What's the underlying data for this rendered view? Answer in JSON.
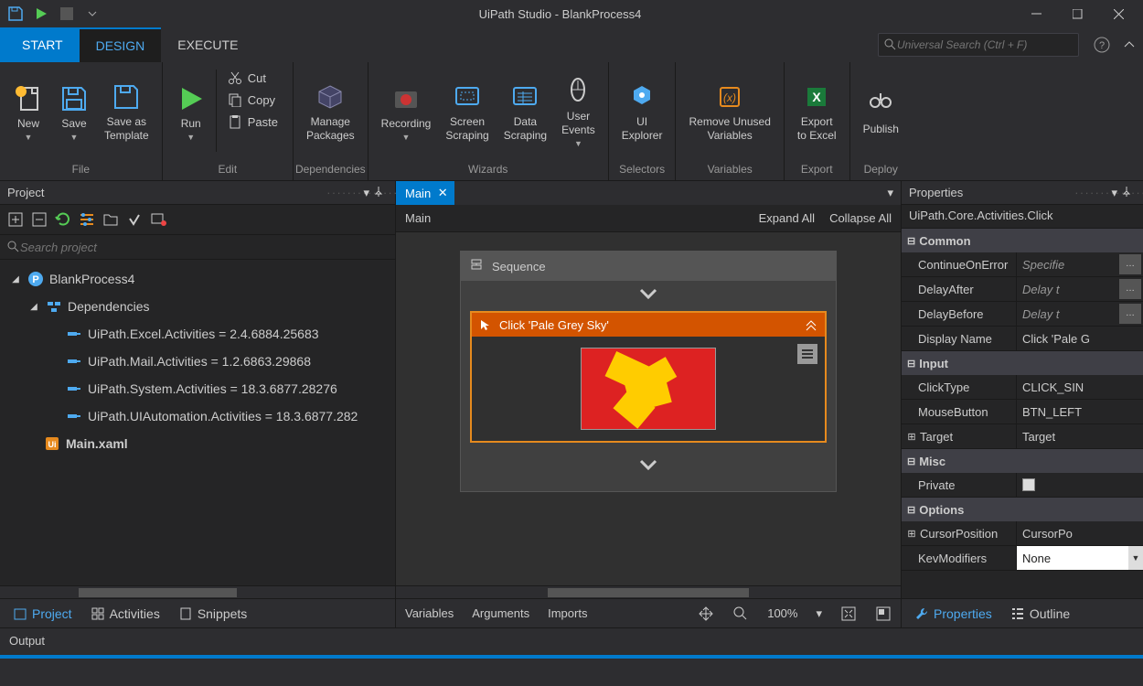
{
  "window": {
    "title": "UiPath Studio - BlankProcess4"
  },
  "mainTabs": {
    "start": "START",
    "design": "DESIGN",
    "execute": "EXECUTE"
  },
  "search": {
    "placeholder": "Universal Search (Ctrl + F)"
  },
  "ribbon": {
    "new": "New",
    "save": "Save",
    "saveAsTemplate": "Save as\nTemplate",
    "run": "Run",
    "cut": "Cut",
    "copy": "Copy",
    "paste": "Paste",
    "managePackages": "Manage\nPackages",
    "recording": "Recording",
    "screenScraping": "Screen\nScraping",
    "dataScraping": "Data\nScraping",
    "userEvents": "User\nEvents",
    "uiExplorer": "UI\nExplorer",
    "removeUnused": "Remove Unused\nVariables",
    "exportExcel": "Export\nto Excel",
    "publish": "Publish",
    "groups": {
      "file": "File",
      "edit": "Edit",
      "dependencies": "Dependencies",
      "wizards": "Wizards",
      "selectors": "Selectors",
      "variables": "Variables",
      "export": "Export",
      "deploy": "Deploy"
    }
  },
  "projectPanel": {
    "title": "Project",
    "searchPlaceholder": "Search project",
    "projectName": "BlankProcess4",
    "dependenciesLabel": "Dependencies",
    "deps": [
      "UiPath.Excel.Activities = 2.4.6884.25683",
      "UiPath.Mail.Activities = 1.2.6863.29868",
      "UiPath.System.Activities = 18.3.6877.28276",
      "UiPath.UIAutomation.Activities = 18.3.6877.282"
    ],
    "mainFile": "Main.xaml",
    "tabs": {
      "project": "Project",
      "activities": "Activities",
      "snippets": "Snippets"
    }
  },
  "designer": {
    "tabName": "Main",
    "breadcrumb": "Main",
    "expandAll": "Expand All",
    "collapseAll": "Collapse All",
    "sequenceLabel": "Sequence",
    "clickLabel": "Click 'Pale Grey Sky'",
    "footer": {
      "variables": "Variables",
      "arguments": "Arguments",
      "imports": "Imports",
      "zoom": "100%"
    }
  },
  "properties": {
    "title": "Properties",
    "className": "UiPath.Core.Activities.Click",
    "cats": {
      "common": "Common",
      "input": "Input",
      "misc": "Misc",
      "options": "Options"
    },
    "common": {
      "continueOnError": "ContinueOnError",
      "continueOnErrorVal": "Specifie",
      "delayAfter": "DelayAfter",
      "delayAfterVal": "Delay t",
      "delayBefore": "DelayBefore",
      "delayBeforeVal": "Delay t",
      "displayName": "Display Name",
      "displayNameVal": "Click 'Pale G"
    },
    "input": {
      "clickType": "ClickType",
      "clickTypeVal": "CLICK_SIN",
      "mouseButton": "MouseButton",
      "mouseButtonVal": "BTN_LEFT",
      "target": "Target",
      "targetVal": "Target"
    },
    "misc": {
      "private": "Private"
    },
    "options": {
      "cursorPosition": "CursorPosition",
      "cursorPositionVal": "CursorPo",
      "keyModifiers": "KevModifiers",
      "keyModifiersVal": "None"
    },
    "tabs": {
      "properties": "Properties",
      "outline": "Outline"
    }
  },
  "output": "Output"
}
